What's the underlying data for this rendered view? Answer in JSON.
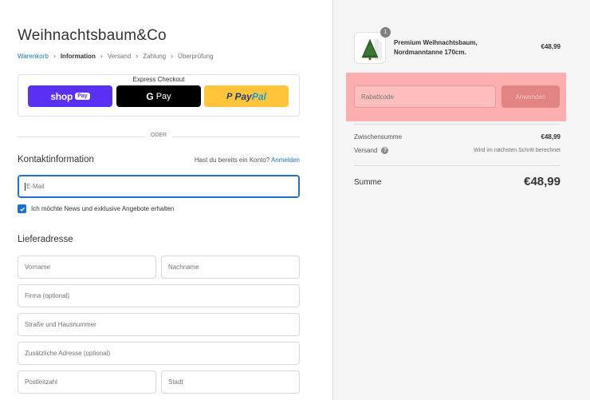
{
  "store": {
    "name": "Weihnachtsbaum&Co"
  },
  "breadcrumb": [
    {
      "label": "Warenkorb",
      "state": "link"
    },
    {
      "label": "Information",
      "state": "active"
    },
    {
      "label": "Versand",
      "state": "inactive"
    },
    {
      "label": "Zahlung",
      "state": "inactive"
    },
    {
      "label": "Überprüfung",
      "state": "inactive"
    }
  ],
  "express": {
    "title": "Express Checkout",
    "shop_pay": {
      "brand": "shop",
      "pay": "Pay"
    },
    "google_pay": {
      "g": "G",
      "label": "Pay"
    },
    "paypal": {
      "p": "P",
      "label_a": "Pay",
      "label_b": "Pal"
    },
    "divider": "ODER"
  },
  "contact": {
    "heading": "Kontaktinformation",
    "account_question": "Hast du bereits ein Konto?",
    "login_link": "Anmelden",
    "email_placeholder": "E-Mail",
    "newsletter_label": "Ich möchte News und exklusive Angebote erhalten",
    "newsletter_checked": true
  },
  "delivery": {
    "heading": "Lieferadresse",
    "first_name": "Vorname",
    "last_name": "Nachname",
    "company": "Firma (optional)",
    "street": "Straße und Hausnummer",
    "address2": "Zusätzliche Adresse (optional)",
    "zip": "Postleitzahl",
    "city": "Stadt"
  },
  "summary": {
    "item": {
      "quantity": "1",
      "name": "Premium Weihnachtsbaum, Nordmanntanne 170cm.",
      "price": "€48,99"
    },
    "discount_placeholder": "Rabattcode",
    "apply_label": "Anwenden",
    "subtotal_label": "Zwischensumme",
    "subtotal_value": "€48,99",
    "shipping_label": "Versand",
    "shipping_help": "?",
    "shipping_value": "Wird im nächsten Schritt berechnet",
    "total_label": "Summe",
    "total_value": "€48,99"
  },
  "colors": {
    "accent": "#1a73c9",
    "shop_pay": "#5a31f4",
    "paypal": "#ffc439",
    "highlight": "#ff9696"
  },
  "icons": [
    "chevron-right-icon",
    "check-icon",
    "help-icon",
    "tree-thumbnail"
  ]
}
